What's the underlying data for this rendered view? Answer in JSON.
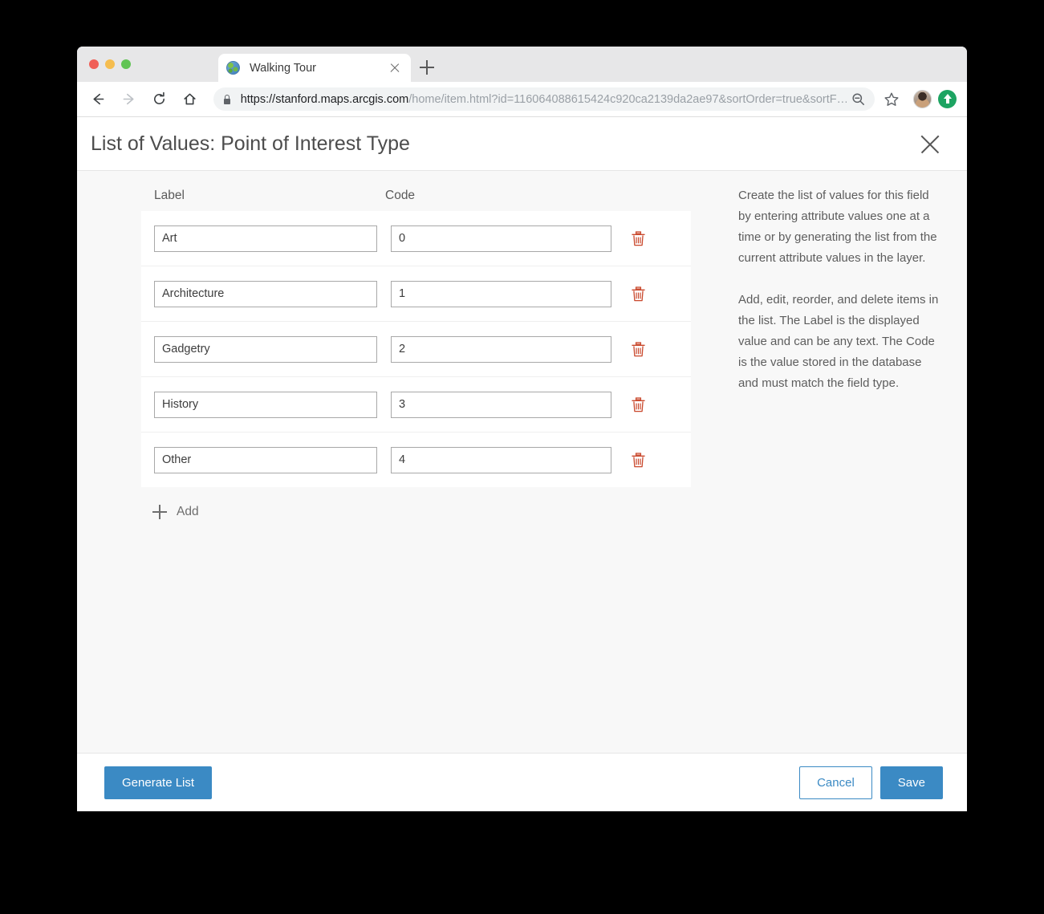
{
  "browser": {
    "tab": {
      "title": "Walking Tour",
      "favicon": "globe-icon",
      "close": "×"
    },
    "newtab_label": "+",
    "url": {
      "scheme": "https://",
      "domain": "stanford.maps.arcgis.com",
      "path": "/home/item.html?id=116064088615424c920ca2139da2ae97&sortOrder=true&sortF…",
      "full": "https://stanford.maps.arcgis.com/home/item.html?id=116064088615424c920ca2139da2ae97&sortOrder=true&sortF…"
    },
    "toolbar": {
      "back": "back-arrow-icon",
      "forward": "forward-arrow-icon",
      "reload": "reload-icon",
      "home": "home-icon",
      "zoom": "zoom-out-icon",
      "bookmark": "star-icon",
      "profile": "avatar-icon",
      "update": "update-arrow-icon"
    }
  },
  "dialog": {
    "title": "List of Values: Point of Interest Type",
    "close_label": "Close",
    "columns": {
      "label": "Label",
      "code": "Code"
    },
    "rows": [
      {
        "label": "Art",
        "code": "0",
        "delete": "delete-icon"
      },
      {
        "label": "Architecture",
        "code": "1",
        "delete": "delete-icon"
      },
      {
        "label": "Gadgetry",
        "code": "2",
        "delete": "delete-icon"
      },
      {
        "label": "History",
        "code": "3",
        "delete": "delete-icon"
      },
      {
        "label": "Other",
        "code": "4",
        "delete": "delete-icon"
      }
    ],
    "add_label": "Add",
    "help": {
      "paragraph1": "Create the list of values for this field by entering attribute values one at a time or by generating the list from the current attribute values in the layer.",
      "paragraph2": "Add, edit, reorder, and delete items in the list. The Label is the displayed value and can be any text. The Code is the value stored in the database and must match the field type."
    },
    "footer": {
      "generate_list": "Generate List",
      "cancel": "Cancel",
      "save": "Save"
    }
  },
  "colors": {
    "accent_blue": "#3b8ac4",
    "delete_red": "#c9472b",
    "page_bg": "#f8f8f8",
    "chrome_gray": "#e7e7e8"
  }
}
